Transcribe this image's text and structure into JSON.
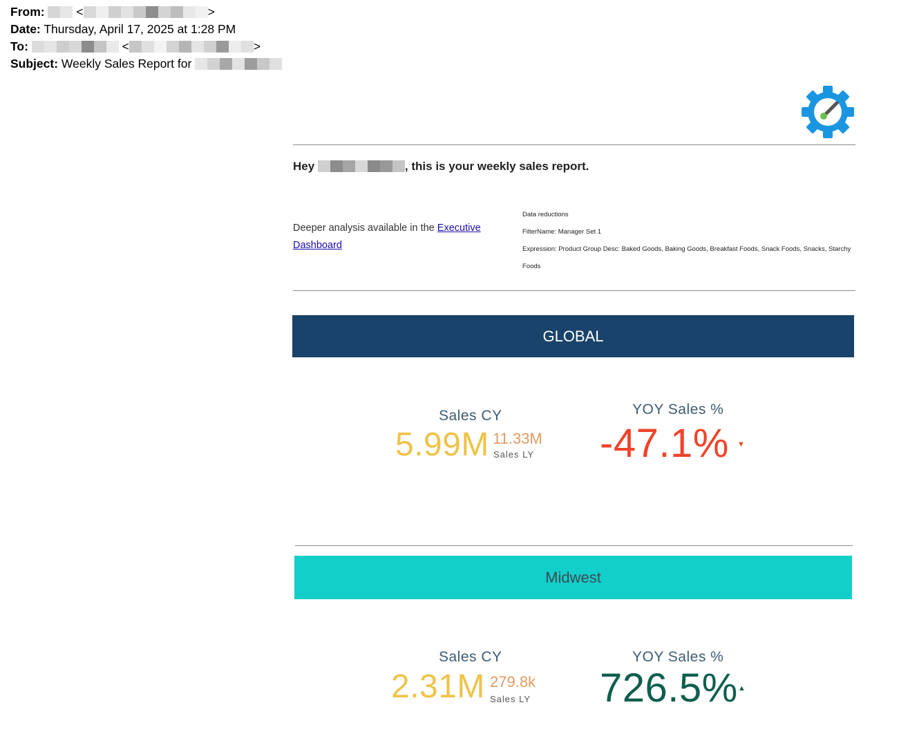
{
  "email": {
    "from_label": "From:",
    "date_label": "Date:",
    "date_value": "Thursday, April 17, 2025 at 1:28 PM",
    "to_label": "To:",
    "subject_label": "Subject:",
    "subject_value": "Weekly Sales Report for",
    "lt": "<",
    "gt": ">"
  },
  "report": {
    "greeting_prefix": "Hey",
    "greeting_suffix": ", this is your weekly sales report.",
    "deeper_text": "Deeper analysis available in the",
    "link_text": "Executive Dashboard",
    "reductions": {
      "title": "Data reductions",
      "filter": "FilterName: Manager Set 1",
      "expression": "Expression: Product Group Desc: Baked Goods, Baking Goods, Breakfast Foods, Snack Foods, Snacks, Starchy Foods"
    },
    "sections": [
      {
        "band": "GLOBAL",
        "sales_cy_label": "Sales CY",
        "sales_cy": "5.99M",
        "sales_ly": "11.33M",
        "sales_ly_label": "Sales LY",
        "yoy_label": "YOY Sales %",
        "yoy": "-47.1%",
        "arrow": "▼",
        "yoy_color": "#f0432a"
      },
      {
        "band": "Midwest",
        "sales_cy_label": "Sales CY",
        "sales_cy": "2.31M",
        "sales_ly": "279.8k",
        "sales_ly_label": "Sales LY",
        "yoy_label": "YOY Sales %",
        "yoy": "726.5%",
        "arrow": "▲",
        "yoy_color": "#0e5e4d"
      }
    ]
  },
  "colors": {
    "global_band": "#1a436b",
    "midwest_band": "#13cfc9",
    "logo": "#1a96e0",
    "sales_cy": "#efc34a",
    "sales_ly": "#e29a62"
  }
}
